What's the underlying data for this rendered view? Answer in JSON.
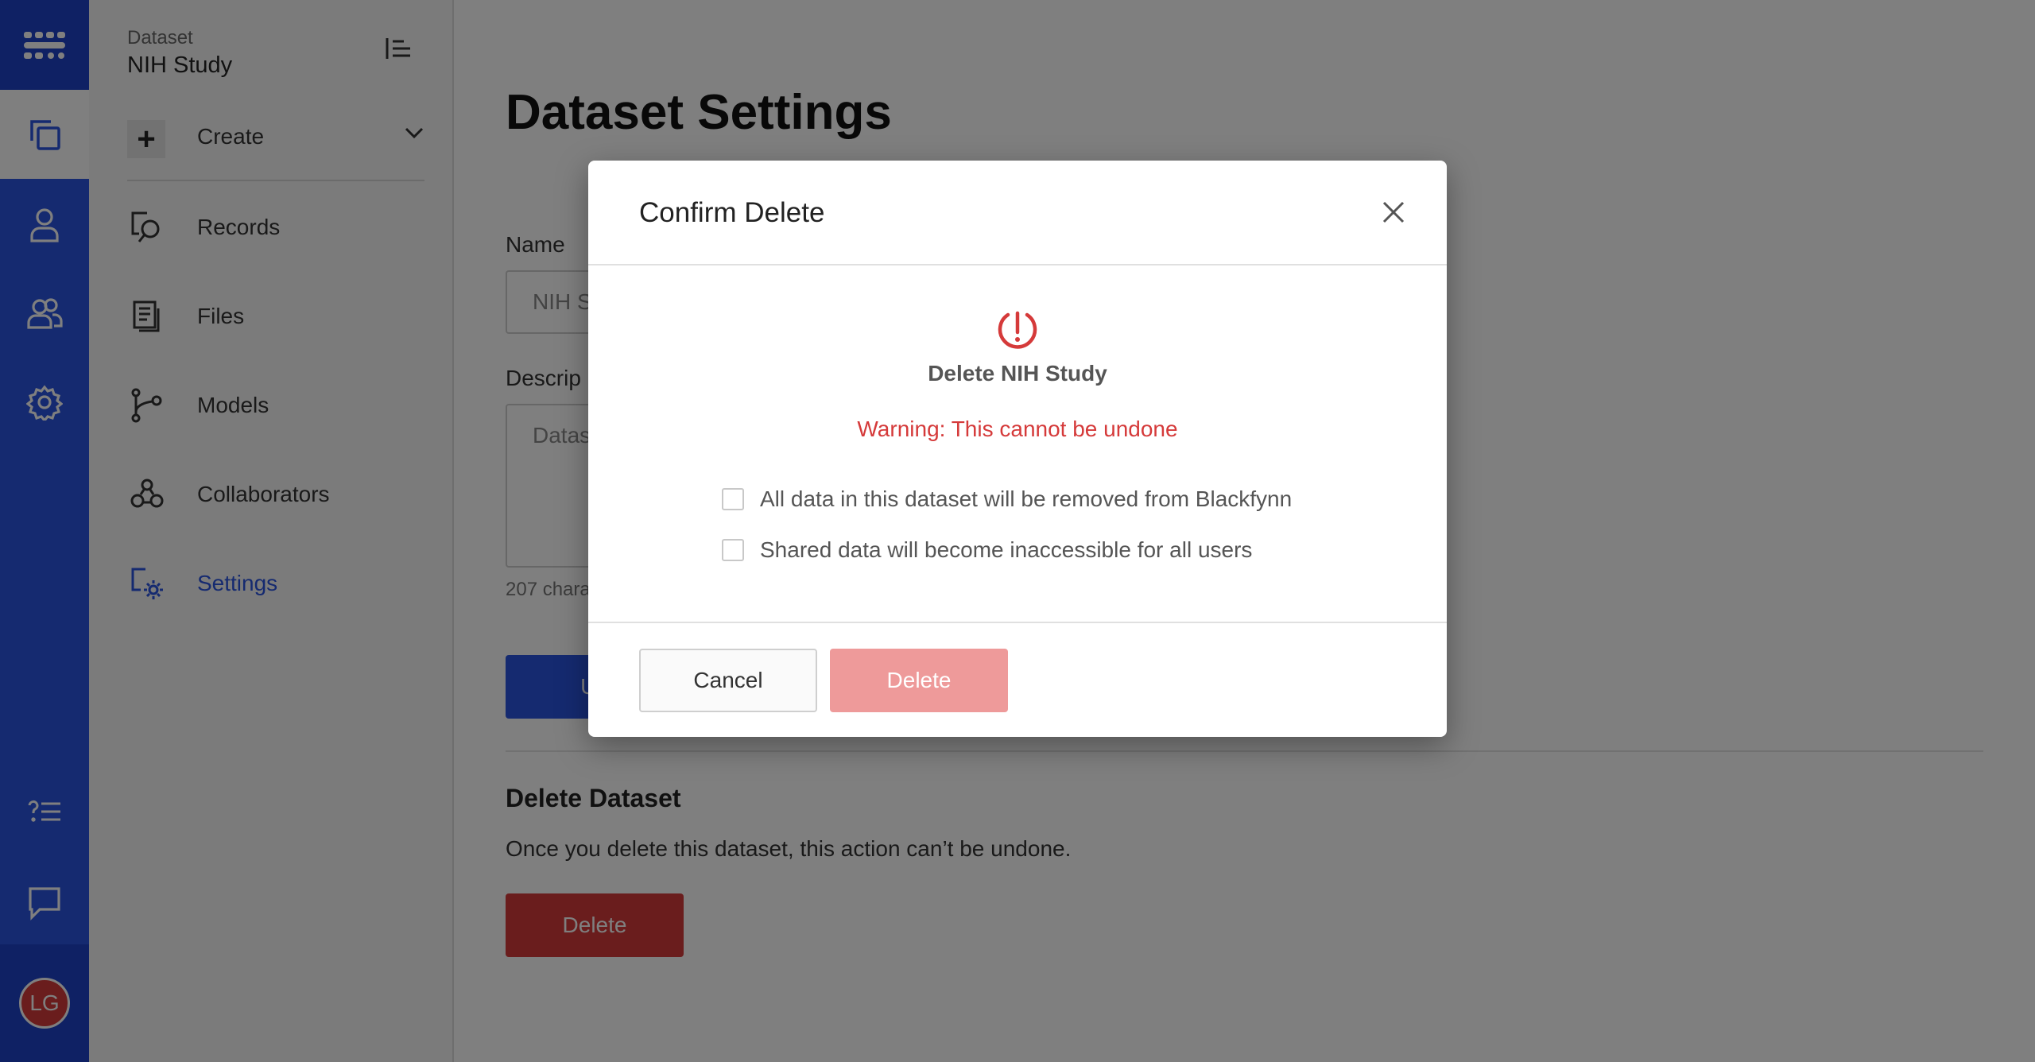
{
  "rail": {
    "top_icon": "grid-apps-icon",
    "items": [
      {
        "icon": "datasets-icon",
        "active": true
      },
      {
        "icon": "person-icon",
        "active": false
      },
      {
        "icon": "people-icon",
        "active": false
      },
      {
        "icon": "settings-gear-icon",
        "active": false
      }
    ],
    "bottom_items": [
      {
        "icon": "help-list-icon"
      },
      {
        "icon": "chat-icon"
      }
    ],
    "avatar_initials": "LG"
  },
  "sidebar": {
    "dataset_label": "Dataset",
    "dataset_name": "NIH Study",
    "create_label": "Create",
    "items": [
      {
        "label": "Records",
        "icon": "records-icon"
      },
      {
        "label": "Files",
        "icon": "files-icon"
      },
      {
        "label": "Models",
        "icon": "models-icon"
      },
      {
        "label": "Collaborators",
        "icon": "collaborators-icon"
      },
      {
        "label": "Settings",
        "icon": "settings-icon"
      }
    ]
  },
  "main": {
    "title": "Dataset Settings",
    "name_label": "Name",
    "name_value": "NIH S",
    "description_label": "Descrip",
    "description_value": "Datas",
    "char_count": "207 chara",
    "update_button": "Up",
    "delete_section_title": "Delete Dataset",
    "delete_section_text": "Once you delete this dataset, this action can’t be undone.",
    "delete_button": "Delete"
  },
  "modal": {
    "title": "Confirm Delete",
    "heading": "Delete NIH Study",
    "warning": "Warning: This cannot be undone",
    "checks": [
      "All data in this dataset will be removed from Blackfynn",
      "Shared data will become inaccessible for all users"
    ],
    "cancel_label": "Cancel",
    "delete_label": "Delete"
  },
  "colors": {
    "brand_blue": "#2a54e0",
    "danger_red": "#d53a3a",
    "disabled_red": "#ee9a9a"
  }
}
